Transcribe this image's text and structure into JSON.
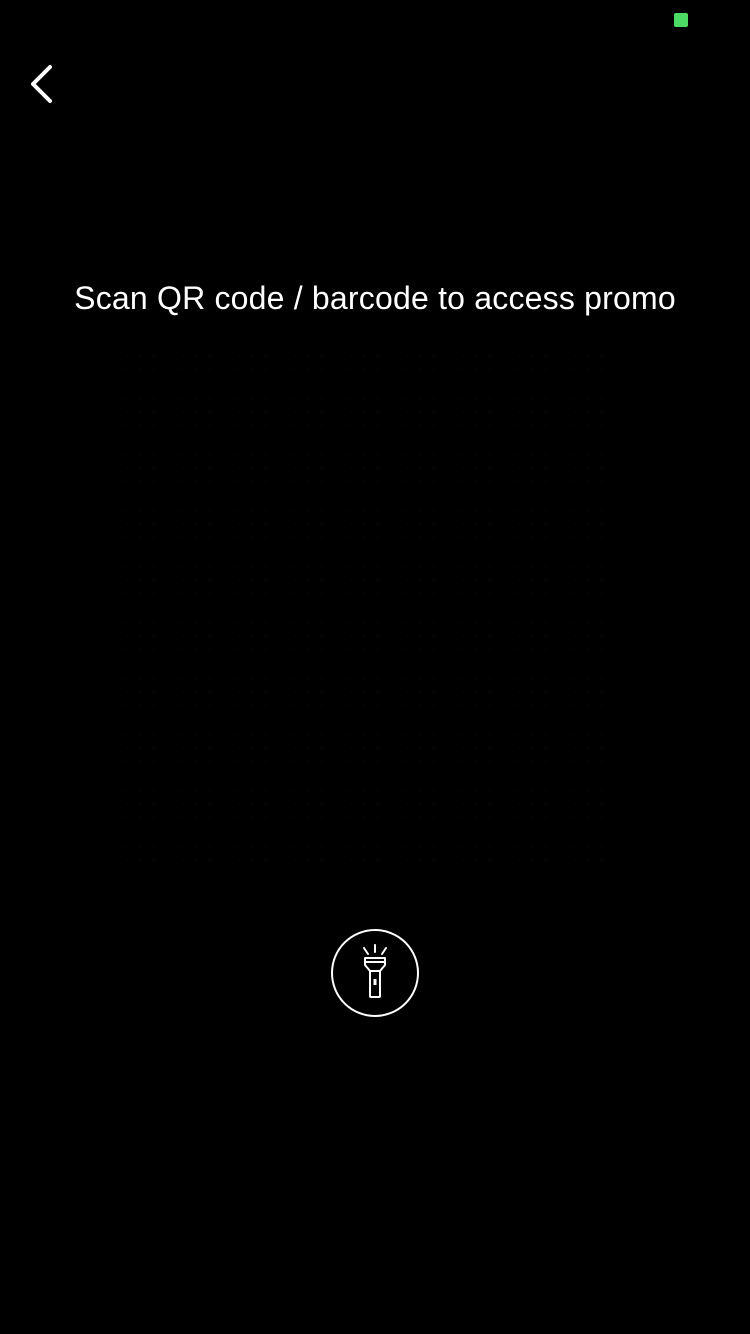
{
  "status_bar": {
    "indicator_color": "#4cd964"
  },
  "nav": {
    "back_icon": "chevron-left-icon"
  },
  "scanner": {
    "instruction": "Scan QR code / barcode to access promo",
    "flashlight_icon": "flashlight-icon"
  },
  "colors": {
    "background": "#000000",
    "text": "#ffffff"
  }
}
